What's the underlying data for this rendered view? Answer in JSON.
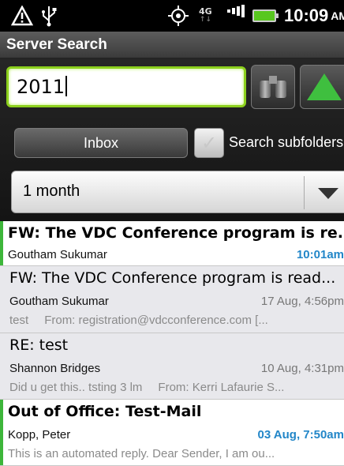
{
  "status_bar": {
    "network": "4G",
    "time": "10:09",
    "ampm": "AM",
    "icons": [
      "warning-icon",
      "usb-icon",
      "gps-icon",
      "network-icon",
      "signal-icon",
      "battery-icon"
    ]
  },
  "title": "Server Search",
  "search": {
    "value": "2011",
    "buttons": [
      "binoculars-icon",
      "expand-triangle-icon"
    ]
  },
  "folder_button": "Inbox",
  "subfolders": {
    "label": "Search subfolders",
    "checked": false
  },
  "date_range": {
    "selected": "1 month"
  },
  "messages": [
    {
      "subject": "FW: The VDC Conference program is re...",
      "sender": "Goutham Sukumar",
      "time": "10:01am",
      "preview_body": "",
      "preview_from": "",
      "unread": true
    },
    {
      "subject": "FW: The VDC Conference program is read...",
      "sender": "Goutham Sukumar",
      "time": "17 Aug, 4:56pm",
      "preview_body": "test",
      "preview_from": "From: registration@vdcconference.com [...",
      "unread": false
    },
    {
      "subject": "RE: test",
      "sender": "Shannon Bridges",
      "time": "10 Aug, 4:31pm",
      "preview_body": "Did u get this.. tsting 3 lm",
      "preview_from": "From: Kerri Lafaurie S...",
      "unread": false
    },
    {
      "subject": "Out of Office: Test-Mail",
      "sender": "Kopp, Peter",
      "time": "03 Aug, 7:50am",
      "preview_body": "This is an automated reply. Dear Sender,  I am ou...",
      "preview_from": "",
      "unread": true
    }
  ],
  "colors": {
    "accent_green": "#3db63a",
    "unread_time_blue": "#2286c8",
    "read_background": "#e8e8ec"
  }
}
